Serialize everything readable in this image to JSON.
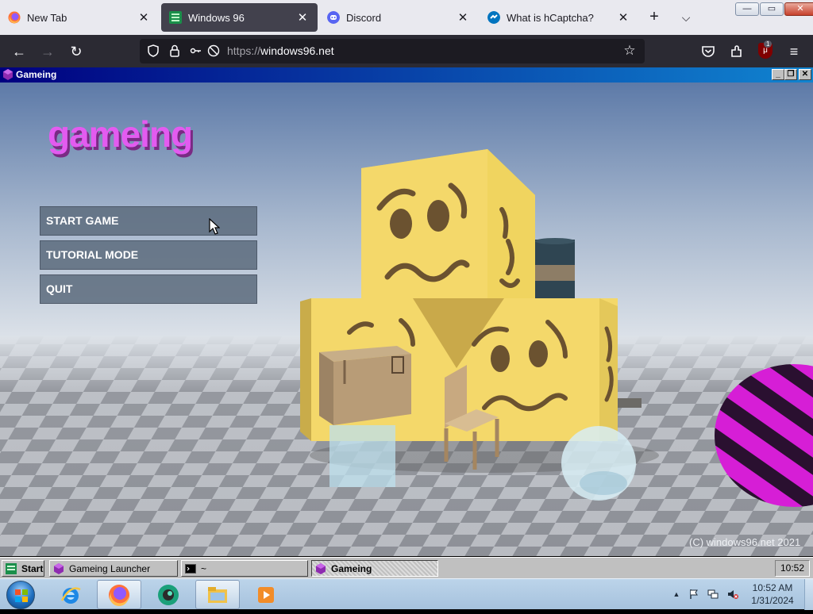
{
  "browser": {
    "tabs": [
      {
        "label": "New Tab",
        "favicon": "firefox-icon"
      },
      {
        "label": "Windows 96",
        "favicon": "windows96-icon",
        "active": true
      },
      {
        "label": "Discord",
        "favicon": "discord-icon"
      },
      {
        "label": "What is hCaptcha?",
        "favicon": "hcaptcha-icon"
      }
    ],
    "tab_close_glyph": "✕",
    "new_tab_glyph": "+",
    "tab_list_glyph": "⌵",
    "window_controls": {
      "minimize": "—",
      "maximize": "▭",
      "close": "✕"
    },
    "nav": {
      "back_glyph": "←",
      "forward_glyph": "→",
      "reload_glyph": "↻",
      "url_scheme": "https://",
      "url_host": "windows96.net",
      "bookmark_glyph": "☆",
      "menu_glyph": "≡",
      "ublock_badge": "1"
    }
  },
  "app_window": {
    "title": "Gameing",
    "controls": {
      "minimize": "_",
      "restore": "❐",
      "close": "✕"
    },
    "game": {
      "title": "gameing",
      "menu": [
        "START GAME",
        "TUTORIAL MODE",
        "QUIT"
      ],
      "copyright": "(C) windows96.net 2021"
    }
  },
  "w96_taskbar": {
    "start_label": "Start",
    "items": [
      {
        "label": "Gameing Launcher",
        "pressed": false
      },
      {
        "label": "~",
        "pressed": false
      },
      {
        "label": "Gameing",
        "pressed": true
      }
    ],
    "clock": "10:52"
  },
  "host_taskbar": {
    "pinned": [
      "internet-explorer-icon",
      "firefox-icon",
      "cortana-icon",
      "file-explorer-icon",
      "media-player-icon"
    ],
    "tray_overflow_glyph": "▲",
    "time": "10:52 AM",
    "date": "1/31/2024"
  },
  "colors": {
    "app_title_gradient_start": "#000080",
    "app_title_gradient_end": "#1084d0",
    "game_title": "#e35bf0",
    "menu_button": "#5c6b7c"
  }
}
